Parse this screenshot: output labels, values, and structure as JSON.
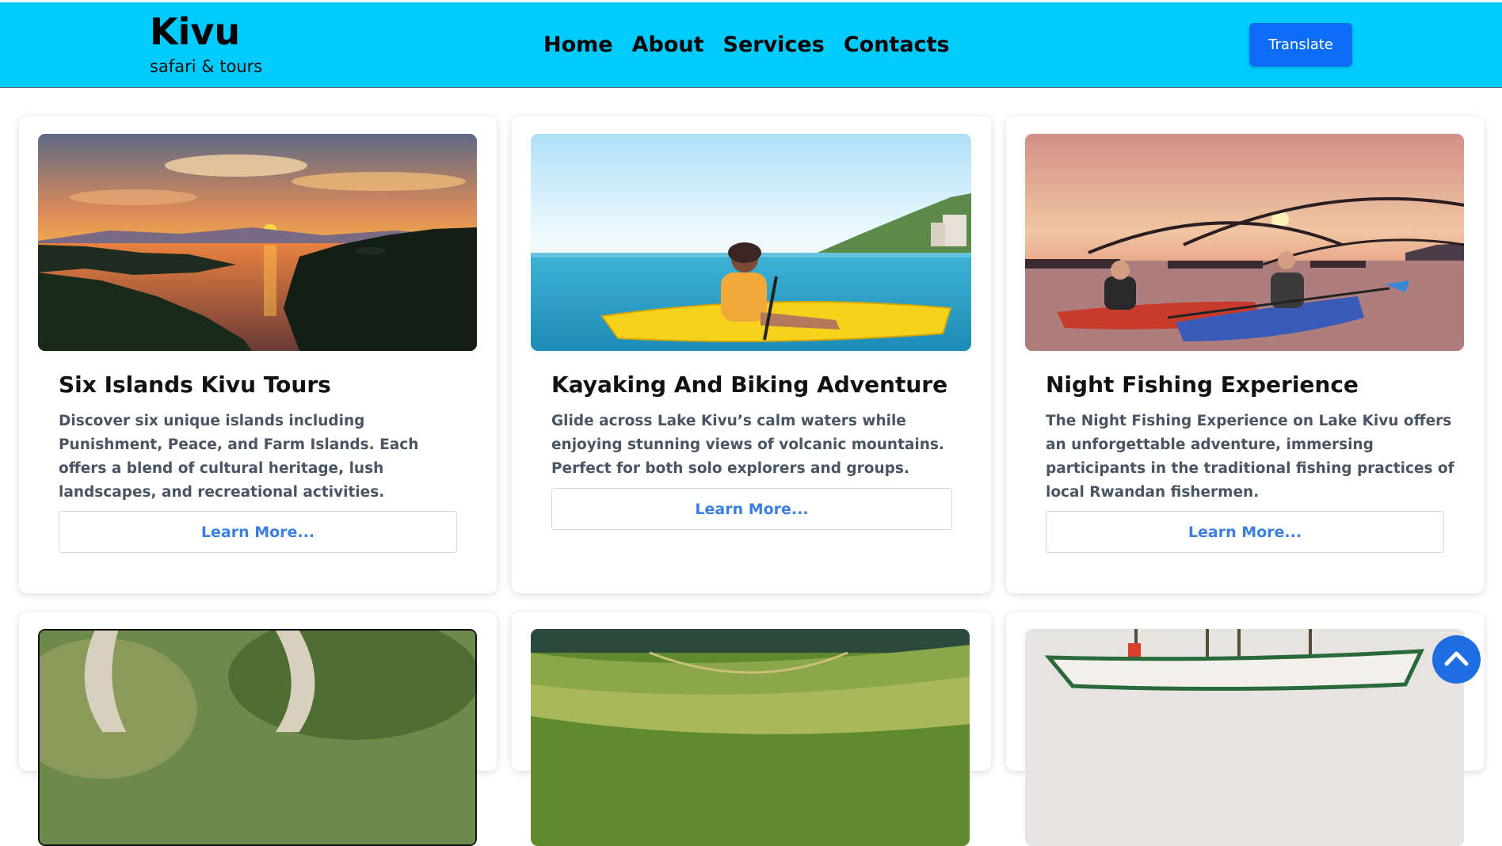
{
  "brand": {
    "name": "Kivu",
    "tagline": "safari & tours"
  },
  "nav": {
    "items": [
      "Home",
      "About",
      "Services",
      "Contacts"
    ]
  },
  "header": {
    "translate_label": "Translate"
  },
  "cards": [
    {
      "title": "Six Islands Kivu Tours",
      "description": "Discover six unique islands including Punishment, Peace, and Farm Islands. Each offers a blend of cultural heritage, lush landscapes, and recreational activities.",
      "button": "Learn More..."
    },
    {
      "title": "Kayaking And Biking Adventure",
      "description": "Glide across Lake Kivu’s calm waters while enjoying stunning views of volcanic mountains. Perfect for both solo explorers and groups.",
      "button": "Learn More..."
    },
    {
      "title": "Night Fishing Experience",
      "description": "The Night Fishing Experience on Lake Kivu offers an unforgettable adventure, immersing participants in the traditional fishing practices of local Rwandan fishermen.",
      "button": "Learn More..."
    }
  ],
  "colors": {
    "header_bg": "#00cbff",
    "primary": "#0b6cf5",
    "link": "#3b7fe0"
  },
  "icons": {
    "scroll_top": "chevron-up-icon"
  }
}
